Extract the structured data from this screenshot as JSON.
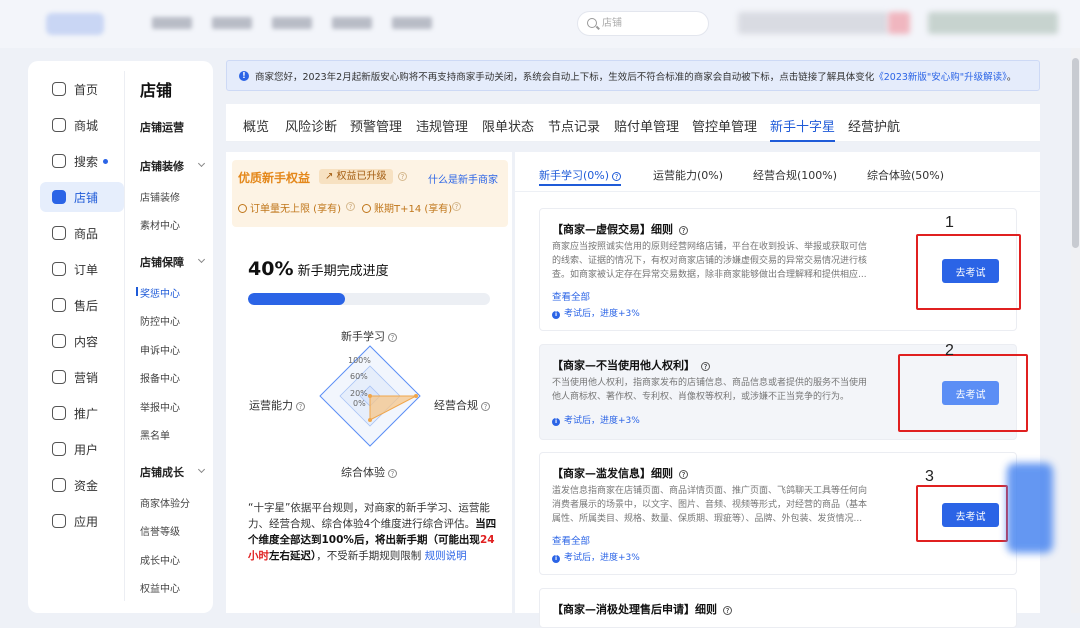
{
  "header": {
    "search_placeholder": "店铺",
    "colors": {
      "accent": "#2b64e6",
      "danger": "#e02020",
      "benefit": "#e4881b"
    }
  },
  "nav": {
    "items": [
      {
        "label": "首页",
        "icon": "home-icon"
      },
      {
        "label": "商城",
        "icon": "mall-icon"
      },
      {
        "label": "搜索",
        "icon": "search-icon"
      },
      {
        "label": "店铺",
        "icon": "store-icon"
      },
      {
        "label": "商品",
        "icon": "goods-icon"
      },
      {
        "label": "订单",
        "icon": "order-icon"
      },
      {
        "label": "售后",
        "icon": "aftersale-icon"
      },
      {
        "label": "内容",
        "icon": "content-icon"
      },
      {
        "label": "营销",
        "icon": "marketing-icon"
      },
      {
        "label": "推广",
        "icon": "promotion-icon"
      },
      {
        "label": "用户",
        "icon": "user-icon"
      },
      {
        "label": "资金",
        "icon": "finance-icon"
      },
      {
        "label": "应用",
        "icon": "apps-icon"
      }
    ],
    "section_title": "店铺",
    "groups": {
      "ops": "店铺运营",
      "decor": "店铺装修",
      "decor_1": "店铺装修",
      "decor_2": "素材中心",
      "guard": "店铺保障",
      "guard_1": "奖惩中心",
      "guard_2": "防控中心",
      "guard_3": "申诉中心",
      "guard_4": "报备中心",
      "guard_5": "举报中心",
      "guard_6": "黑名单",
      "growth": "店铺成长",
      "growth_1": "商家体验分",
      "growth_2": "信誉等级",
      "growth_3": "成长中心",
      "growth_4": "权益中心"
    }
  },
  "notice": {
    "text": "商家您好，2023年2月起新版安心购将不再支持商家手动关闭，系统会自动上下标，生效后不符合标准的商家会自动被下标，点击链接了解具体变化",
    "link": "《2023新版\"安心购\"升级解读》",
    "end": "。"
  },
  "tabs": [
    "概览",
    "风险诊断",
    "预警管理",
    "违规管理",
    "限单状态",
    "节点记录",
    "赔付单管理",
    "管控单管理",
    "新手十字星",
    "经营护航"
  ],
  "benefit": {
    "title": "优质新手权益",
    "badge": "↗ 权益已升级",
    "link": "什么是新手商家",
    "f1": "订单量无上限 (享有)",
    "f2": "账期T+14 (享有)"
  },
  "progress": {
    "percent_label": "40%",
    "title": "新手期完成进度",
    "value": 0.4
  },
  "radar": {
    "top": "新手学习",
    "left": "运营能力",
    "right": "经营合规",
    "bottom": "综合体验",
    "ticks": [
      "100%",
      "60%",
      "20%",
      "0%"
    ]
  },
  "desc": {
    "a": "“十字星”依据平台规则，对商家的新手学习、运营能力、经营合规、综合体验4个维度进行综合评估。",
    "b": "当四个维度全部达到100%后，将出新手期（可能出现",
    "c": "24小时",
    "d": "左右延迟）",
    "e": "，不受新手期规则限制 ",
    "link": "规则说明"
  },
  "subtabs": [
    "新手学习(0%)",
    "运营能力(0%)",
    "经营合规(100%)",
    "综合体验(50%)"
  ],
  "exams": [
    {
      "title": "【商家—虚假交易】细则",
      "text": "商家应当按照诚实信用的原则经营网络店铺，平台在收到投诉、举报或获取可信的线索、证据的情况下，有权对商家店铺的涉嫌虚假交易的异常交易情况进行核查。如商家被认定存在异常交易数据，除非商家能够做出合理解释和提供相应...",
      "more": "查看全部",
      "hint": "考试后，进度+3%",
      "button": "去考试",
      "marker": "1"
    },
    {
      "title": "【商家—不当使用他人权利】",
      "text": "不当使用他人权利，指商家发布的店铺信息、商品信息或者提供的服务不当使用他人商标权、著作权、专利权、肖像权等权利，或涉嫌不正当竞争的行为。",
      "hint": "考试后，进度+3%",
      "button": "去考试",
      "marker": "2"
    },
    {
      "title": "【商家—滥发信息】细则",
      "text": "滥发信息指商家在店铺页面、商品详情页面、推广页面、飞鸽聊天工具等任何向消费者展示的场景中，以文字、图片、音频、视频等形式，对经营的商品（基本属性、所属类目、规格、数量、保质期、瑕疵等）、品牌、外包装、发货情况...",
      "more": "查看全部",
      "hint": "考试后，进度+3%",
      "button": "去考试",
      "marker": "3"
    },
    {
      "title": "【商家—消极处理售后申请】细则"
    }
  ]
}
